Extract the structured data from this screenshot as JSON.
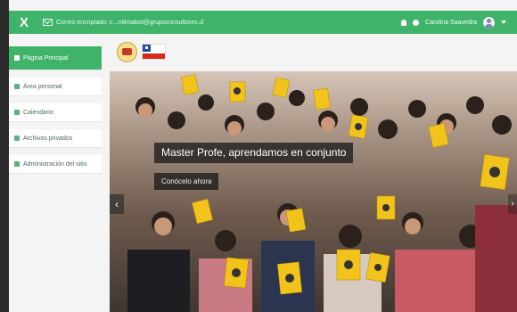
{
  "topbar": {
    "close_glyph": "X",
    "mail_text": "Correo encriptado: c...mlimabot@grupoconsultores.cl",
    "username": "Carolina Saavedra",
    "accent_color": "#3fb36a",
    "icons": [
      "close-icon",
      "mail-icon",
      "bell-icon",
      "chat-icon",
      "avatar",
      "chevron-down-icon"
    ]
  },
  "sidebar": {
    "items": [
      {
        "label": "Página Principal",
        "icon": "home-icon",
        "active": true
      },
      {
        "label": "Área personal",
        "icon": "dashboard-icon",
        "active": false
      },
      {
        "label": "Calendario",
        "icon": "calendar-icon",
        "active": false
      },
      {
        "label": "Archivos privados",
        "icon": "file-icon",
        "active": false
      },
      {
        "label": "Administración del sitio",
        "icon": "wrench-icon",
        "active": false
      }
    ]
  },
  "banner": {
    "title": "Master Profe, aprendamos en conjunto",
    "subtitle": "Conócelo ahora",
    "prev_glyph": "‹",
    "next_glyph": "›"
  }
}
